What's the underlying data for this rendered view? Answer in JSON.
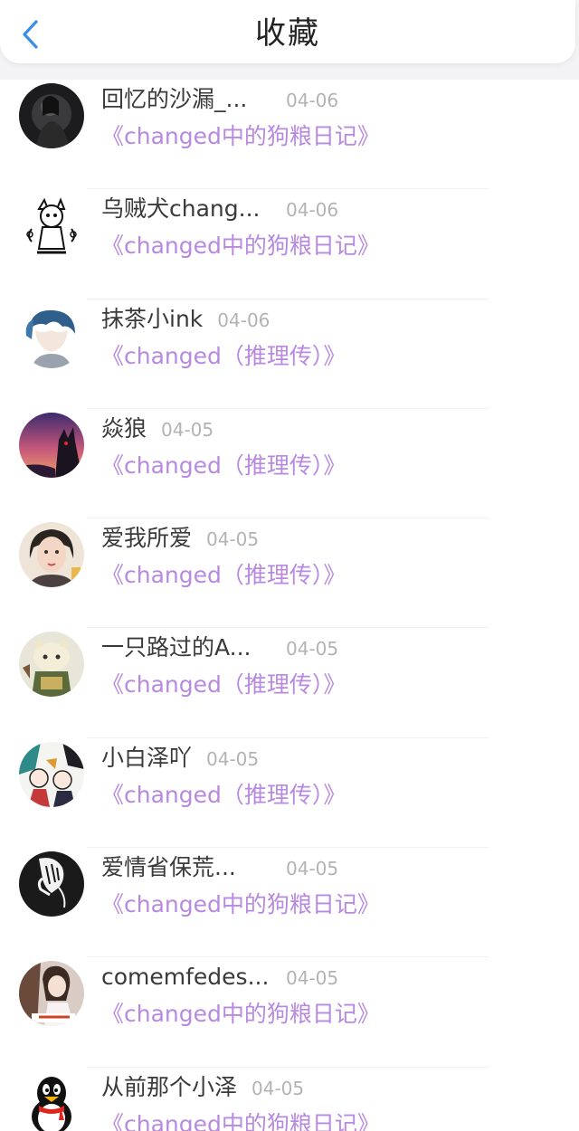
{
  "header": {
    "title": "收藏",
    "back_icon": "chevron-left-icon",
    "accent_color": "#3a8ee6"
  },
  "list": [
    {
      "name": "回忆的沙漏_...",
      "date": "04-06",
      "book": "《changed中的狗粮日记》",
      "avatar": "dark-figure-avatar"
    },
    {
      "name": "乌贼犬chang...",
      "date": "04-06",
      "book": "《changed中的狗粮日记》",
      "avatar": "sketch-creature-avatar"
    },
    {
      "name": "抹茶小ink",
      "date": "04-06",
      "book": "《changed（推理传）》",
      "avatar": "blue-hair-avatar"
    },
    {
      "name": "焱狼",
      "date": "04-05",
      "book": "《changed（推理传）》",
      "avatar": "sunset-wolf-avatar"
    },
    {
      "name": "爱我所爱⁣",
      "date": "04-05",
      "book": "《changed（推理传）》",
      "avatar": "woman-photo-avatar"
    },
    {
      "name": "一只路过的A...",
      "date": "04-05",
      "book": "《changed（推理传）》",
      "avatar": "plush-avatar"
    },
    {
      "name": "小白泽吖",
      "date": "04-05",
      "book": "《changed（推理传）》",
      "avatar": "anime-group-avatar"
    },
    {
      "name": "爱情省保荒...",
      "date": "04-05",
      "book": "《changed中的狗粮日记》",
      "avatar": "hand-drawing-avatar"
    },
    {
      "name": "comemfedes...",
      "date": "04-05",
      "book": "《changed中的狗粮日记》",
      "avatar": "girl-photo-avatar"
    },
    {
      "name": "从前那个小泽",
      "date": "04-05",
      "book": "《changed中的狗粮日记》",
      "avatar": "qq-penguin-avatar"
    }
  ],
  "colors": {
    "book_link": "#b889e0",
    "name_text": "#3a3a3a",
    "date_text": "#b3b3b3"
  }
}
